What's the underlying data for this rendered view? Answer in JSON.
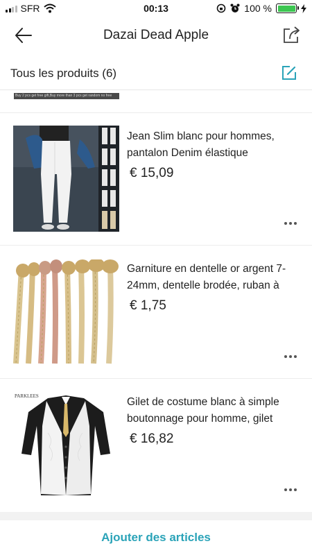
{
  "status_bar": {
    "carrier": "SFR",
    "time": "00:13",
    "battery": "100 %",
    "battery_level": 1.0
  },
  "nav": {
    "title": "Dazai Dead Apple",
    "back_icon": "arrow-left-icon",
    "share_icon": "share-icon"
  },
  "section": {
    "title": "Tous les produits (6)",
    "edit_icon": "edit-icon"
  },
  "partial_banner": {
    "text": "Buy 2 pcs get free gift,Buy more than 3 pcs get random no free"
  },
  "products": [
    {
      "title": "Jean Slim blanc pour hommes, pantalon Denim élastique",
      "price": "€ 15,09",
      "image": "white-jeans-photo"
    },
    {
      "title": "Garniture en dentelle or argent 7-24mm, dentelle brodée, ruban à",
      "price": "€ 1,75",
      "image": "lace-trim-photo"
    },
    {
      "title": "Gilet de costume blanc à simple boutonnage pour homme, gilet",
      "price": "€ 16,82",
      "image": "white-vest-photo",
      "image_brand": "PARKLEES"
    }
  ],
  "footer": {
    "add_label": "Ajouter des articles"
  },
  "colors": {
    "accent": "#2aa3b8",
    "battery": "#3cc651"
  }
}
